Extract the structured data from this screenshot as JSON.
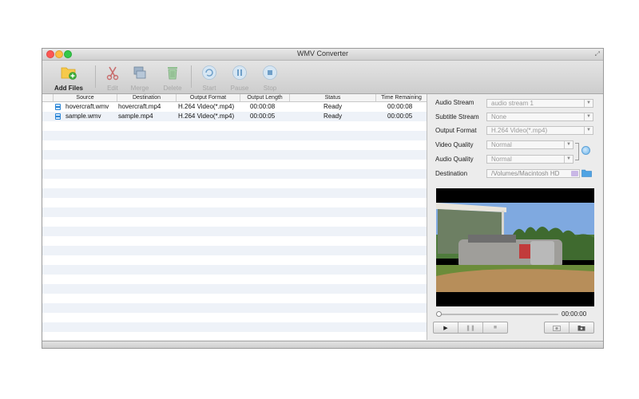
{
  "window": {
    "title": "WMV Converter"
  },
  "toolbar": {
    "add_files": "Add Files",
    "edit": "Edit",
    "merge": "Merge",
    "delete": "Delete",
    "start": "Start",
    "pause": "Pause",
    "stop": "Stop"
  },
  "table": {
    "columns": [
      "Source",
      "Destination",
      "Output Format",
      "Output Length",
      "Status",
      "Time Remaining"
    ],
    "rows": [
      {
        "source": "hovercraft.wmv",
        "destination": "hovercraft.mp4",
        "format": "H.264 Video(*.mp4)",
        "length": "00:00:08",
        "status": "Ready",
        "remaining": "00:00:08"
      },
      {
        "source": "sample.wmv",
        "destination": "sample.mp4",
        "format": "H.264 Video(*.mp4)",
        "length": "00:00:05",
        "status": "Ready",
        "remaining": "00:00:05"
      }
    ]
  },
  "settings": {
    "audio_stream_label": "Audio Stream",
    "audio_stream_value": "audio stream 1",
    "subtitle_stream_label": "Subtitle Stream",
    "subtitle_stream_value": "None",
    "output_format_label": "Output Format",
    "output_format_value": "H.264 Video(*.mp4)",
    "video_quality_label": "Video Quality",
    "video_quality_value": "Normal",
    "audio_quality_label": "Audio Quality",
    "audio_quality_value": "Normal",
    "destination_label": "Destination",
    "destination_value": "/Volumes/Macintosh HD"
  },
  "player": {
    "time": "00:00:00",
    "progress": 0
  }
}
